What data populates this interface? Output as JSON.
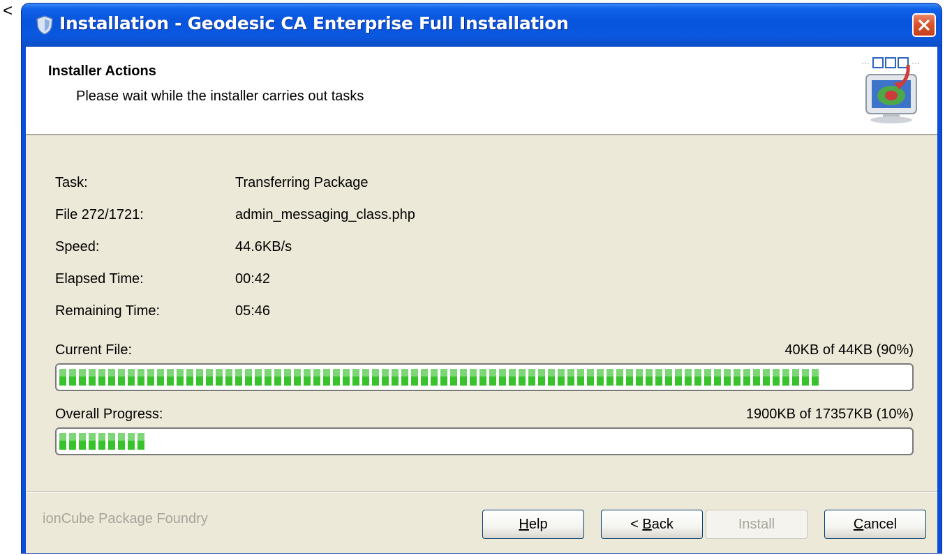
{
  "stray_char": "<",
  "window": {
    "title": "Installation - Geodesic CA Enterprise Full Installation",
    "close_label": "✕"
  },
  "header": {
    "title": "Installer Actions",
    "subtitle": "Please wait while the installer carries out tasks"
  },
  "fields": [
    {
      "label": "Task:",
      "value": "Transferring Package"
    },
    {
      "label": "File 272/1721:",
      "value": "admin_messaging_class.php"
    },
    {
      "label": "Speed:",
      "value": "44.6KB/s"
    },
    {
      "label": "Elapsed Time:",
      "value": "00:42"
    },
    {
      "label": "Remaining Time:",
      "value": "05:46"
    }
  ],
  "current_file": {
    "label": "Current File:",
    "stat": "40KB of 44KB (90%)",
    "progress": 0.9
  },
  "overall_progress": {
    "label": "Overall Progress:",
    "stat": "1900KB of 17357KB (10%)",
    "progress": 0.1
  },
  "footer": {
    "brand": "ionCube Package Foundry",
    "buttons": {
      "help": {
        "label": "Help",
        "mnemonic": "H",
        "rest": "elp"
      },
      "back": {
        "label": "< Back",
        "pre": "< ",
        "mnemonic": "B",
        "rest": "ack"
      },
      "install": {
        "label": "Install"
      },
      "cancel": {
        "label": "Cancel",
        "mnemonic": "C",
        "rest": "ancel"
      }
    }
  },
  "colors": {
    "titlebar": "#0854dd",
    "progress_green": "#38c22c",
    "dialog_bg": "#ece9d8"
  }
}
